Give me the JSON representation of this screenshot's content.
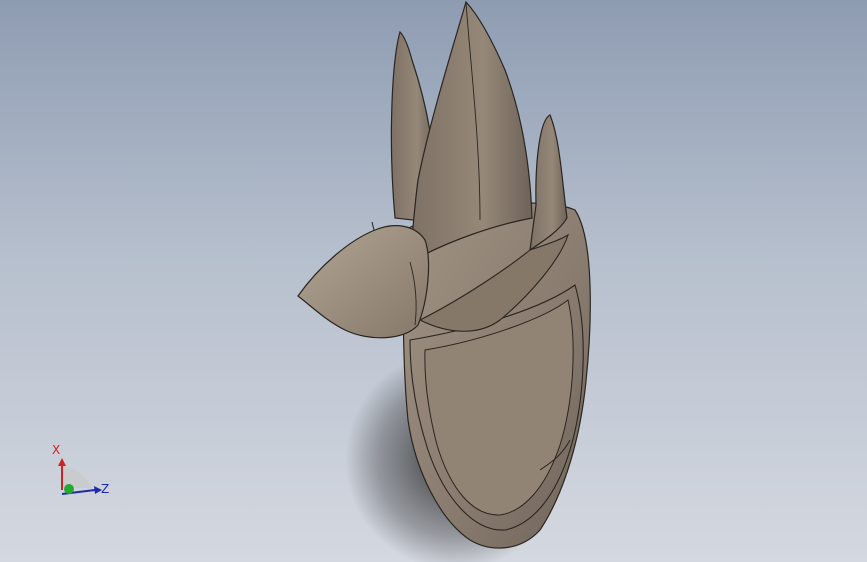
{
  "viewport": {
    "background_top": "#8e9cb2",
    "background_bottom": "#d4d8e0",
    "model": {
      "name": "propeller",
      "blade_count": 3,
      "color": "#8a7d70"
    }
  },
  "triad": {
    "x_label": "X",
    "z_label": "Z",
    "x_color": "#cc2222",
    "y_color": "#22aa33",
    "z_color": "#1f2aa8"
  }
}
